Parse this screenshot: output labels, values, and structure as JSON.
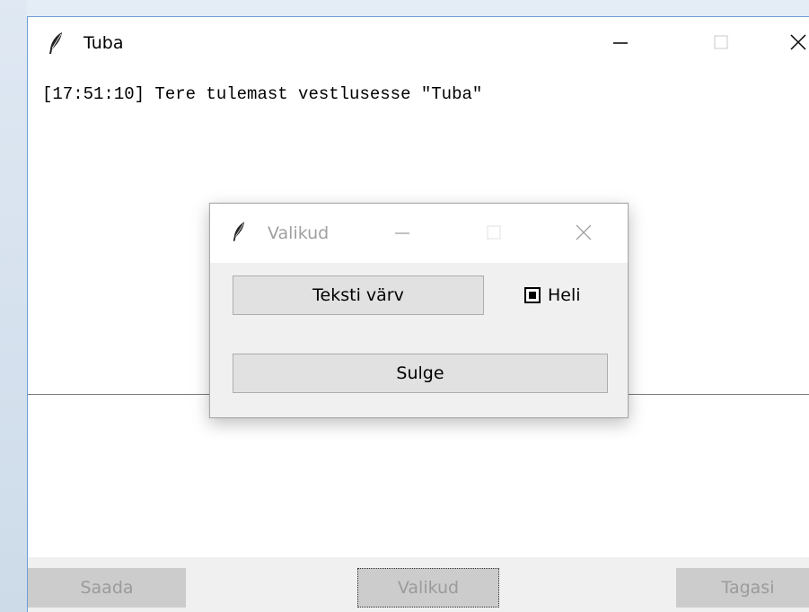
{
  "main_window": {
    "title": "Tuba",
    "chat": {
      "lines": [
        "[17:51:10] Tere tulemast vestlusesse \"Tuba\""
      ]
    },
    "buttons": {
      "send": "Saada",
      "options": "Valikud",
      "back": "Tagasi"
    }
  },
  "dialog": {
    "title": "Valikud",
    "text_color_button": "Teksti värv",
    "sound_checkbox": {
      "label": "Heli",
      "checked": true
    },
    "close_button": "Sulge"
  },
  "icons": {
    "app": "feather-icon",
    "minimize": "minimize-icon",
    "maximize": "maximize-icon",
    "close": "close-icon"
  },
  "colors": {
    "window_border": "#6f9ed6",
    "button_bar": "#f0f0f0",
    "disabled_text": "#9b9b9b"
  }
}
